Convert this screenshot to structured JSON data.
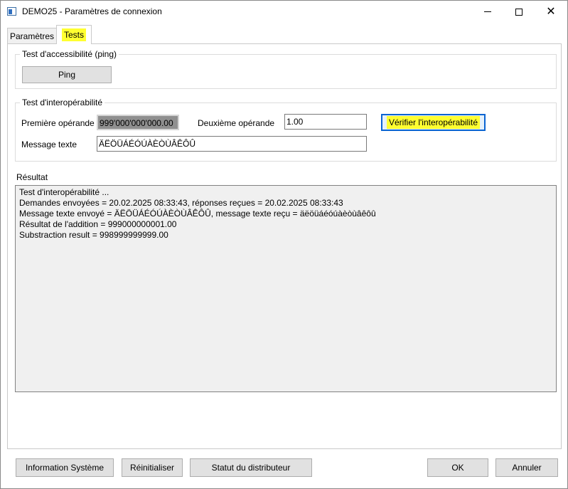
{
  "window": {
    "title": "DEMO25 - Paramètres de connexion",
    "minimize_icon": "minimize-icon",
    "maximize_icon": "maximize-icon",
    "close_glyph": "✕"
  },
  "tabs": [
    {
      "label": "Paramètres",
      "selected": false
    },
    {
      "label": "Tests",
      "selected": true,
      "highlight_color": "#ffff30"
    }
  ],
  "ping_group": {
    "title": "Test d'accessibilité (ping)",
    "button_label": "Ping"
  },
  "interop_group": {
    "title": "Test d'interopérabilité",
    "first_operand_label": "Première opérande",
    "first_operand_value": "999'000'000'000.00",
    "second_operand_label": "Deuxième opérande",
    "second_operand_value": "1.00",
    "verify_button_label": "Vérifier l'interopérabilité",
    "message_label": "Message texte",
    "message_value": "ÄËÖÜÁÉÓÚÀÈÒÙÂÊÔÛ"
  },
  "result": {
    "title": "Résultat",
    "lines": [
      "Test d'interopérabilité ...",
      "Demandes envoyées = 20.02.2025 08:33:43, réponses reçues = 20.02.2025 08:33:43",
      "Message texte envoyé =  ÄËÖÜÁÉÓÚÀÈÒÙÂÊÔÛ, message texte reçu = äëöüáéóúàèòùâêôû",
      "Résultat de l'addition = 999000000001.00",
      "Substraction result = 998999999999.00"
    ]
  },
  "footer": {
    "system_info_label": "Information Système",
    "reset_label": "Réinitialiser",
    "distributor_status_label": "Statut du distributeur",
    "ok_label": "OK",
    "cancel_label": "Annuler"
  },
  "colors": {
    "highlight": "#ffff30",
    "focus_border": "#0a64d2",
    "result_background": "#f0f0f0"
  }
}
